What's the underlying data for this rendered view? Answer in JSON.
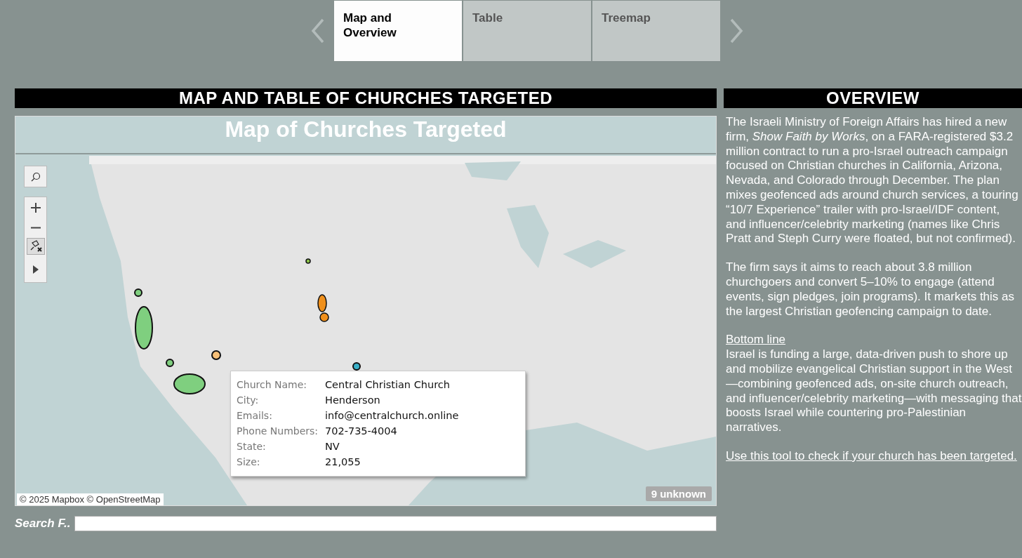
{
  "tabs": [
    {
      "label": "Map and\nOverview",
      "selected": true
    },
    {
      "label": "Table",
      "selected": false
    },
    {
      "label": "Treemap",
      "selected": false
    }
  ],
  "map_panel": {
    "header": "MAP AND TABLE OF CHURCHES TARGETED",
    "title": "Map of Churches Targeted",
    "tooltip": {
      "rows": [
        {
          "label": "Church Name:",
          "value": "Central Christian Church"
        },
        {
          "label": "City:",
          "value": "Henderson"
        },
        {
          "label": "Emails:",
          "value": "info@centralchurch.online"
        },
        {
          "label": "Phone Numbers:",
          "value": "702-735-4004"
        },
        {
          "label": "State:",
          "value": "NV"
        },
        {
          "label": "Size:",
          "value": "21,055"
        }
      ]
    },
    "attribution": "© 2025 Mapbox © OpenStreetMap",
    "unknown_badge": "9 unknown"
  },
  "search": {
    "label": "Search F.."
  },
  "overview": {
    "header": "OVERVIEW",
    "paragraphs": [
      "The Israeli Ministry of Foreign Affairs has hired a new firm, *Show Faith by Works*, on a FARA-registered $3.2 million contract to run a pro-Israel outreach campaign focused on Christian churches in California, Arizona, Nevada, and Colorado through December. The plan mixes geofenced ads around church services, a touring “10/7 Experience” trailer with pro-Israel/IDF content, and influencer/celebrity marketing (names like Chris Pratt and Steph Curry were floated, but not confirmed).",
      "The firm says it aims to reach about 3.8 million churchgoers and convert 5–10% to engage (attend events, sign pledges, join programs). It markets this as the largest Christian geofencing campaign to date."
    ],
    "subheading": "Bottom line",
    "bottom_text": "Israel is funding a large, data-driven push to shore up and mobilize evangelical Christian support in the West—combining geofenced ads, on-site church outreach, and influencer/celebrity marketing—with messaging that boosts Israel while countering pro-Palestinian narratives.",
    "link": "Use this tool to check if your church has been targeted."
  }
}
